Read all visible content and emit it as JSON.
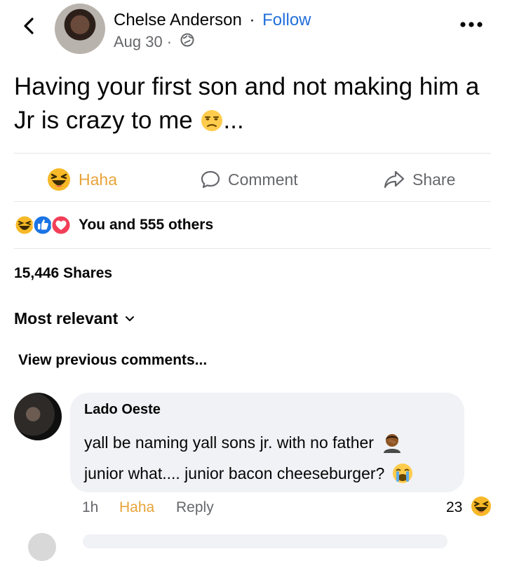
{
  "header": {
    "author": "Chelse Anderson",
    "separator": "·",
    "follow": "Follow",
    "date": "Aug 30",
    "meta_separator": "·",
    "privacy_icon": "globe-icon",
    "back_icon": "chevron-left-icon",
    "more_icon": "more-horizontal-icon"
  },
  "post": {
    "text": "Having your first son and not making him a Jr is crazy to me",
    "emoji": "unamused-face-emoji",
    "suffix": "..."
  },
  "actions": {
    "haha": "Haha",
    "comment": "Comment",
    "share": "Share"
  },
  "reactions": {
    "icons": [
      "haha-reaction",
      "like-reaction",
      "love-reaction"
    ],
    "summary": "You and 555 others"
  },
  "shares": "15,446 Shares",
  "sort": {
    "label": "Most relevant"
  },
  "view_previous": "View previous comments...",
  "comment": {
    "name": "Lado Oeste",
    "line1": "yall be naming yall sons jr. with no father",
    "line1_emoji": "man-facepalming-emoji",
    "line2": "junior what.... junior bacon cheeseburger?",
    "line2_emoji": "loudly-crying-face-emoji",
    "time": "1h",
    "reaction_label": "Haha",
    "reply": "Reply",
    "reaction_count": "23"
  },
  "colors": {
    "link_blue": "#216fdb",
    "haha_orange": "#e8a33a",
    "secondary_text": "#65676b",
    "bubble_bg": "#f0f2f5"
  }
}
